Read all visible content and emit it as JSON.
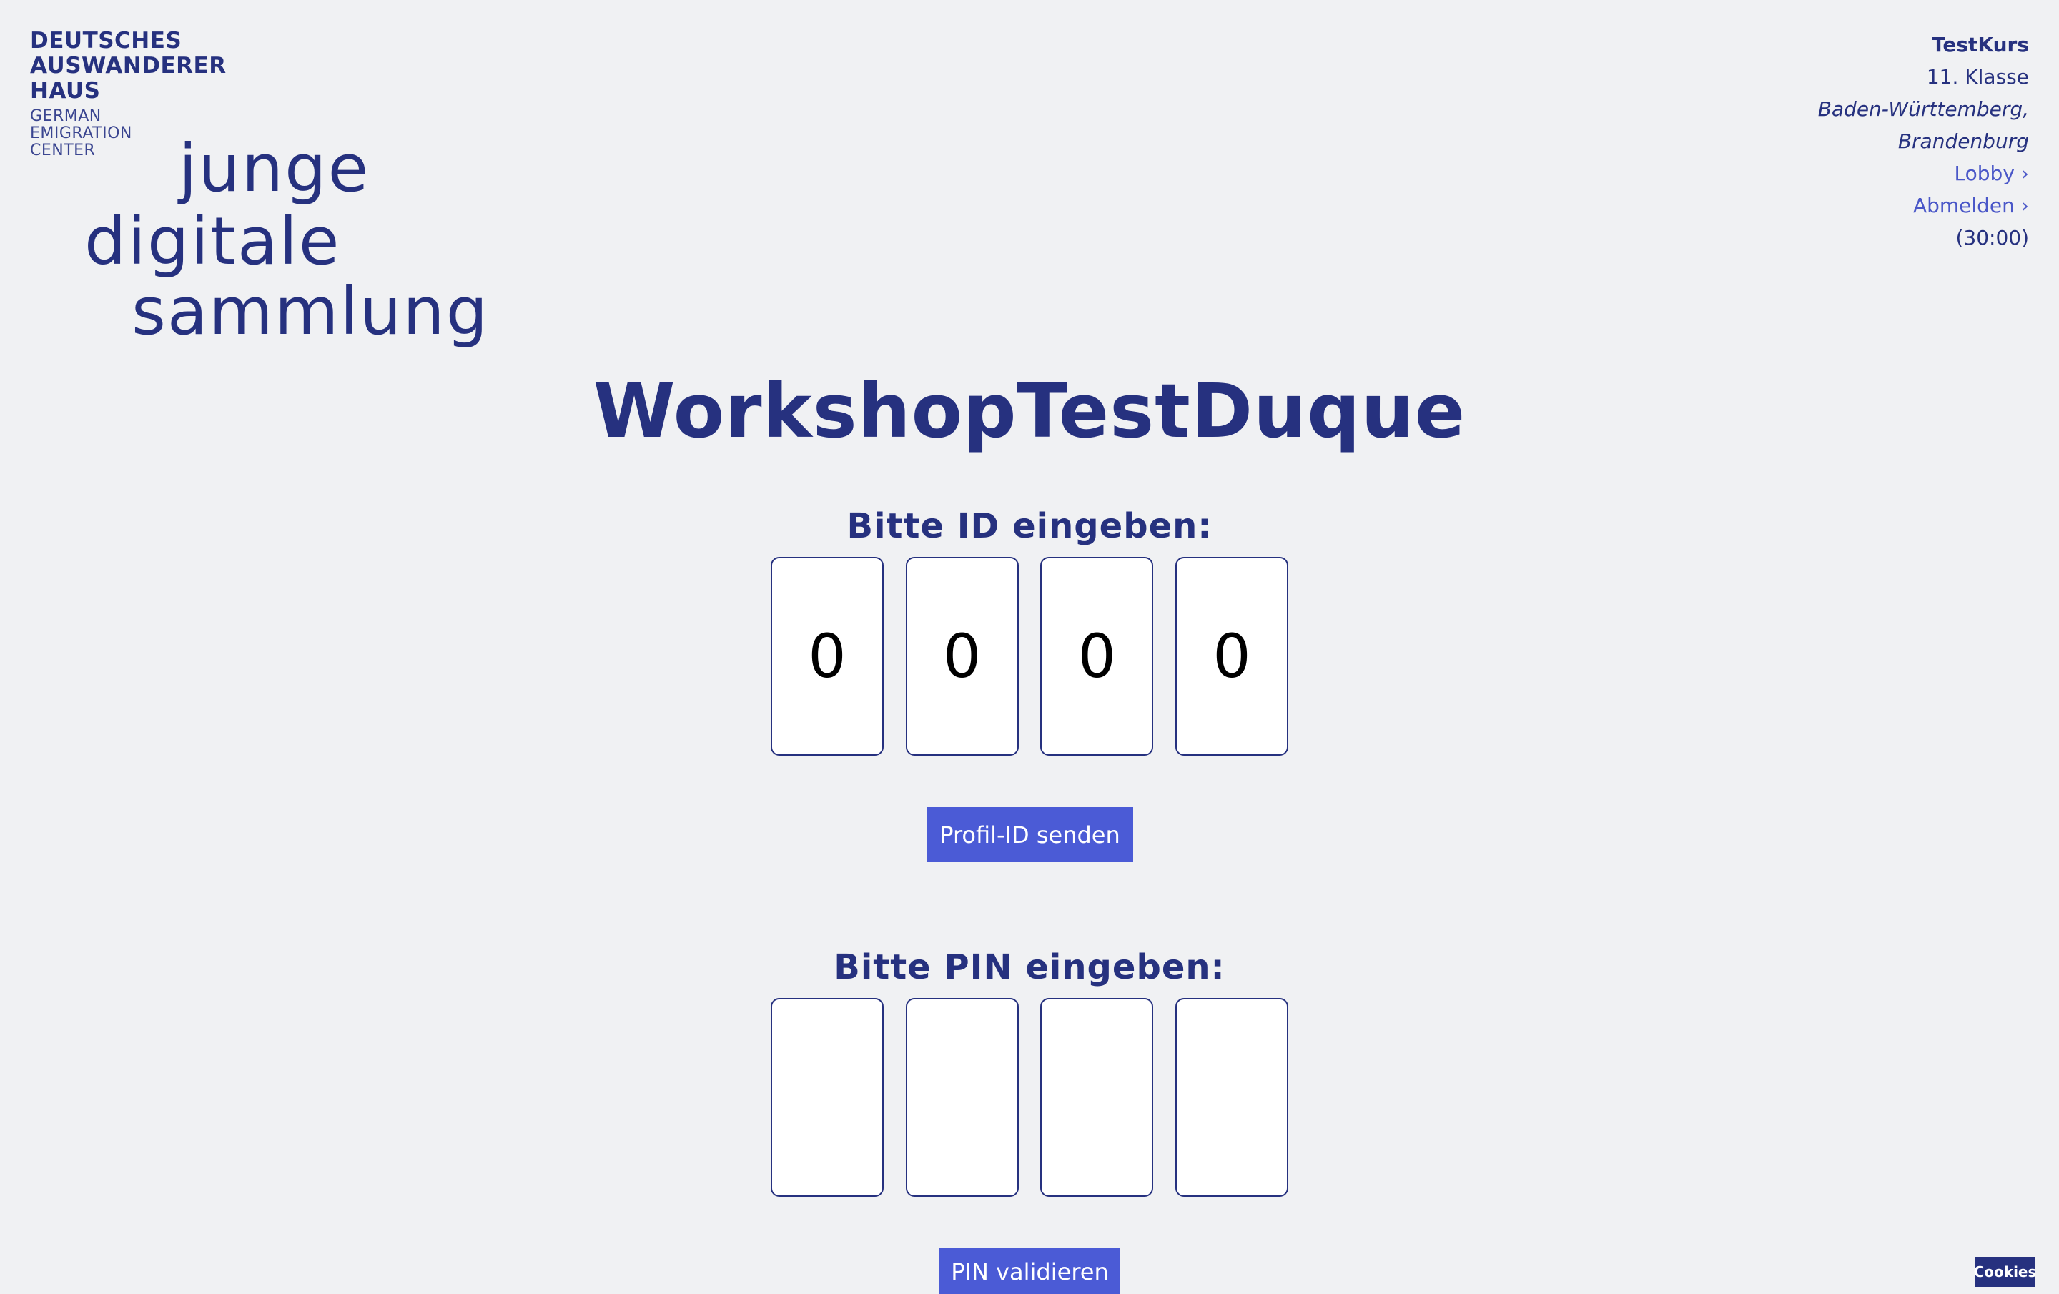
{
  "brand": {
    "lines": [
      "DEUTSCHES",
      "AUSWANDERER",
      "HAUS"
    ],
    "sub_lines": [
      "GERMAN",
      "EMIGRATION",
      "CENTER"
    ],
    "logo_words": [
      "junge",
      "digitale",
      "sammlung"
    ]
  },
  "session": {
    "course": "TestKurs",
    "grade": "11. Klasse",
    "states_line1": "Baden-Württemberg,",
    "states_line2": "Brandenburg",
    "lobby_link": "Lobby ›",
    "logout_link": "Abmelden ›",
    "timer": "(30:00)"
  },
  "main": {
    "title": "WorkshopTestDuque",
    "id_prompt": "Bitte ID eingeben:",
    "id_digits": [
      "0",
      "0",
      "0",
      "0"
    ],
    "send_button": "Profil-ID senden",
    "pin_prompt": "Bitte PIN eingeben:",
    "pin_digits": [
      "",
      "",
      "",
      ""
    ],
    "pin_button": "PIN validieren"
  },
  "footer": {
    "cookies_button": "Cookies"
  },
  "colors": {
    "background": "#f0f1f3",
    "brand_navy": "#26317f",
    "accent_button": "#4b5bd6",
    "link": "#4a57c8"
  }
}
